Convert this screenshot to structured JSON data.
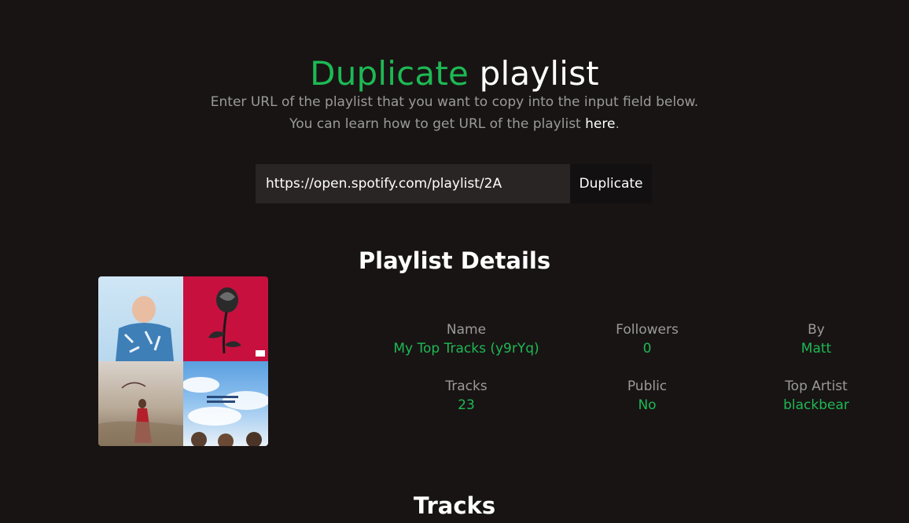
{
  "header": {
    "title_accent": "Duplicate",
    "title_rest": "playlist"
  },
  "intro": {
    "line1": "Enter URL of the playlist that you want to copy into the input field below.",
    "line2_prefix": "You can learn how to get URL of the playlist ",
    "line2_link": "here",
    "line2_suffix": "."
  },
  "form": {
    "url_value": "https://open.spotify.com/playlist/2A",
    "button_label": "Duplicate"
  },
  "details": {
    "title": "Playlist Details",
    "stats": [
      {
        "label": "Name",
        "value": "My Top Tracks (y9rYq)"
      },
      {
        "label": "Followers",
        "value": "0"
      },
      {
        "label": "By",
        "value": "Matt"
      },
      {
        "label": "Tracks",
        "value": "23"
      },
      {
        "label": "Public",
        "value": "No"
      },
      {
        "label": "Top Artist",
        "value": "blackbear"
      }
    ]
  },
  "next_section": {
    "title": "Tracks"
  },
  "colors": {
    "background": "#191414",
    "accent": "#1db954",
    "muted_text": "#9a9a9a"
  }
}
